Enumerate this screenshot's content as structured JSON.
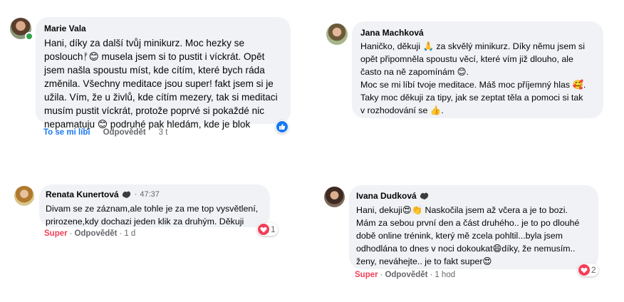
{
  "comments": [
    {
      "author": "Marie Vala",
      "text": "Hani, díky za další tvůj minikurz. Moc hezky se\nposlouchᚠ😊 musela jsem si to pustit i víckrát. Opět\njsem našla spoustu míst, kde cítím, které bych ráda\nzměnila. Všechny meditace jsou super! fakt jsem si je\nužila. Vím, že u živlů, kde cítím mezery, tak si meditaci\nmusím pustit víckrát, protože poprvé si pokaždé nic\nnepamatuju 😊 podruhé pak hledám, kde je blok",
      "reaction_label": "To se mi líbí",
      "reply_label": "Odpovědět",
      "time": "3 t",
      "reaction_icon": "like-icon"
    },
    {
      "author": "Jana Machková",
      "text": "Haničko, děkuji 🙏 za skvělý minikurz. Díky němu jsem si\nopět připomněla spoustu věcí, které vím již dlouho, ale\nčasto na ně zapomínám 😊.\nMoc se mi líbí tvoje meditace. Máš moc příjemný hlas 🥰.\nTaky moc děkuji za tipy, jak se zeptat těla a pomoci si tak\nv rozhodování se 👍."
    },
    {
      "author": "Renata Kunertová",
      "timestamp": "47:37",
      "text": "Divam se ze záznam,ale tohle je za me top vysvětlení,\nprirozene,kdy dochazi jeden klik za druhým. Děkuji",
      "reaction_label": "Super",
      "reply_label": "Odpovědět",
      "time": "1 d",
      "reaction_count": "1",
      "reaction_icon": "heart-icon"
    },
    {
      "author": "Ivana Dudková",
      "text": "Hani, dekuji😍👏 Naskočila jsem až včera a je to bozi.\nMám za sebou první den a část druhého.. je to po dlouhé\ndobě online trénink, který mě zcela pohltil...byla jsem\nodhodlána to dnes v noci dokoukat😄díky, že nemusím..\nženy, neváhejte.. je to fakt super😍",
      "reaction_label": "Super",
      "reply_label": "Odpovědět",
      "time": "1 hod",
      "reaction_count": "2",
      "reaction_icon": "heart-icon"
    }
  ],
  "separator": "·",
  "colors": {
    "bubble": "#f0f2f5",
    "like": "#1877f2",
    "super": "#f33e58",
    "meta": "#65676b",
    "online": "#31a24c"
  }
}
